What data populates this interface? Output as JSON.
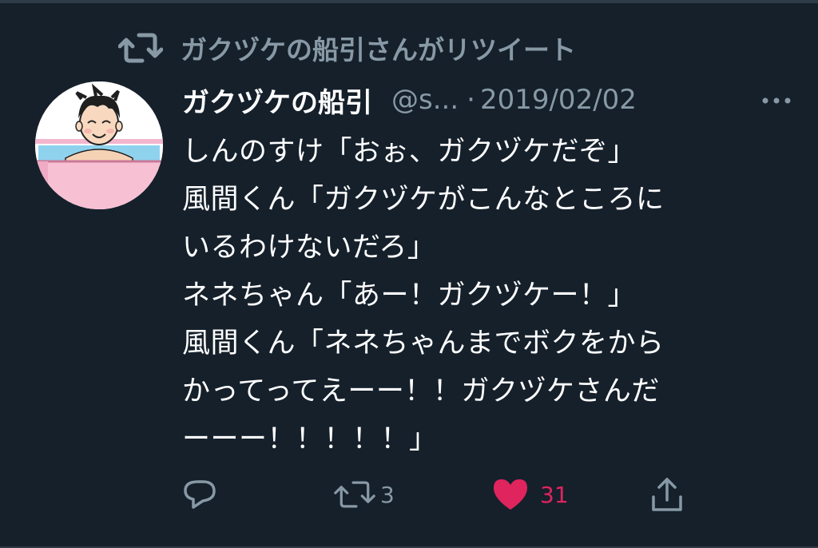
{
  "retweet_context": {
    "label": "ガクヅケの船引さんがリツイート",
    "icon": "retweet-icon"
  },
  "author": {
    "display_name": "ガクヅケの船引",
    "handle": "@s...",
    "separator": "·",
    "date": "2019/02/02",
    "avatar_icon": "avatar-bath-illustration"
  },
  "tweet_text": {
    "lines": [
      "しんのすけ「おぉ、ガクヅケだぞ」",
      "風間くん「ガクヅケがこんなところに",
      "いるわけないだろ」",
      "ネネちゃん「あー！ガクヅケー！」",
      "風間くん「ネネちゃんまでボクをから",
      "かってってえーー！！ガクヅケさんだ",
      "ーーー！！！！！」"
    ]
  },
  "actions": {
    "reply_count": "",
    "retweet_count": "3",
    "like_count": "31",
    "like_color": "#e0245e",
    "muted_color": "#8899a6"
  },
  "colors": {
    "background": "#15202b",
    "text": "#ffffff",
    "secondary": "#8899a6"
  }
}
